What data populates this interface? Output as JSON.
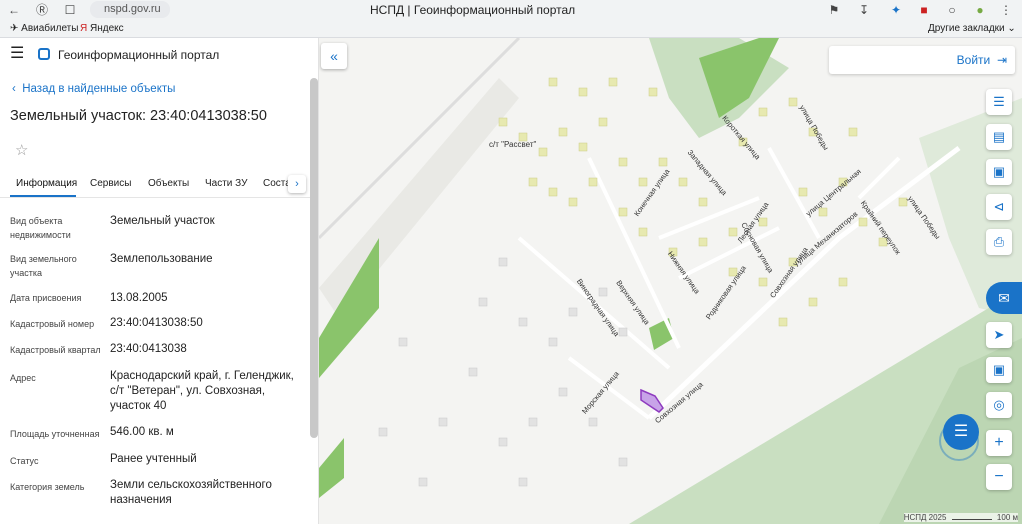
{
  "browser": {
    "url": "nspd.gov.ru",
    "tab_title": "НСПД | Геоинформационный портал",
    "bookmarks": [
      "Авиабилеты",
      "Яндекс"
    ],
    "other_bookmarks": "Другие закладки"
  },
  "portal": {
    "title": "Геоинформационный портал",
    "back_link": "Назад в найденные объекты",
    "heading": "Земельный участок: 23:40:0413038:50"
  },
  "tabs": [
    "Информация",
    "Сервисы",
    "Объекты",
    "Части ЗУ",
    "Соста"
  ],
  "fields": [
    {
      "label": "Вид объекта недвижимости",
      "value": "Земельный участок"
    },
    {
      "label": "Вид земельного участка",
      "value": "Землепользование"
    },
    {
      "label": "Дата присвоения",
      "value": "13.08.2005"
    },
    {
      "label": "Кадастровый номер",
      "value": "23:40:0413038:50"
    },
    {
      "label": "Кадастровый квартал",
      "value": "23:40:0413038"
    },
    {
      "label": "Адрес",
      "value": "Краснодарский край, г. Геленджик, с/т \"Ветеран\", ул. Совхозная, участок 40"
    },
    {
      "label": "Площадь уточненная",
      "value": "546.00 кв. м"
    },
    {
      "label": "Статус",
      "value": "Ранее учтенный"
    },
    {
      "label": "Категория земель",
      "value": "Земли сельскохозяйственного назначения"
    }
  ],
  "map": {
    "login_label": "Войти",
    "settlement_label": "с/т \"Рассвет\"",
    "streets": [
      "Короткая улица",
      "улица Победы",
      "Западная улица",
      "Конечная улица",
      "Лесная улица",
      "улица Центральная",
      "Сосновая улица",
      "улица Механизаторов",
      "Крайний переулок",
      "улица Победы",
      "Нижняя улица",
      "Верхняя улица",
      "Виноградная улица",
      "Родниковая улица",
      "Совхозная улица",
      "Морская улица",
      "Совхозная улица"
    ],
    "copyright": "НСПД 2025",
    "scale_label": "100 м",
    "colors": {
      "accent": "#1a73c8",
      "parcel": "#c8a3e8",
      "forest": "#c9dfc1",
      "green": "#8ac46b",
      "building": "#e7e9b0"
    }
  }
}
